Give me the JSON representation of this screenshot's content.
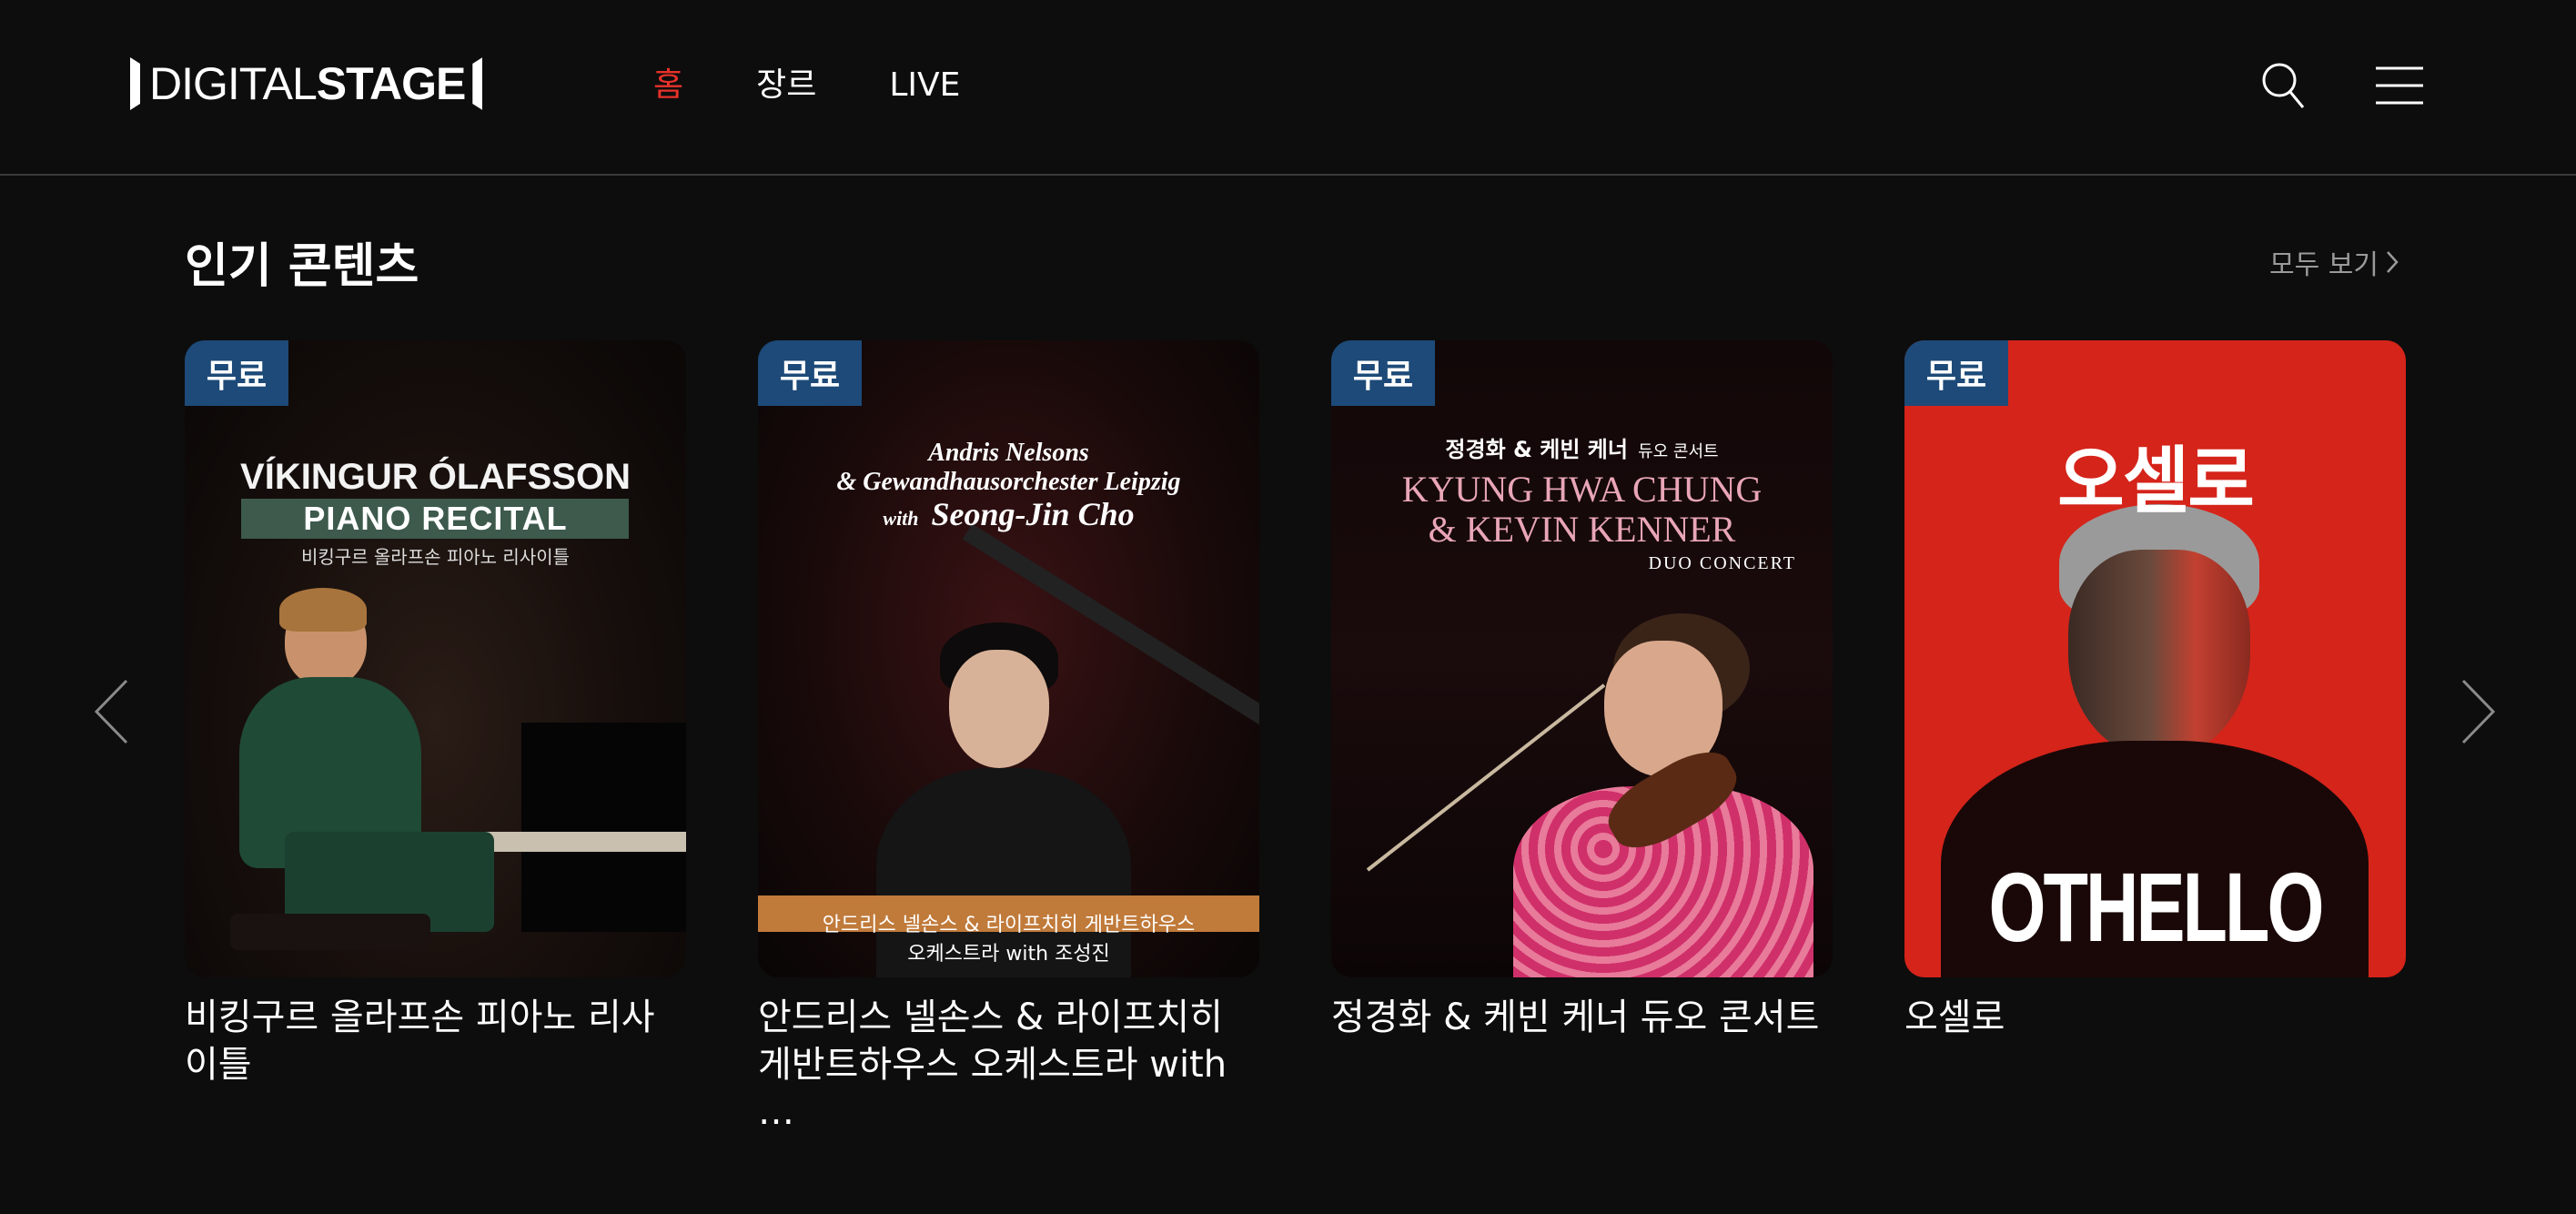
{
  "header": {
    "logo_part1": "DIGITAL",
    "logo_part2": "STAGE",
    "nav": [
      {
        "label": "홈",
        "active": true
      },
      {
        "label": "장르",
        "active": false
      },
      {
        "label": "LIVE",
        "active": false
      }
    ]
  },
  "section": {
    "title": "인기 콘텐츠",
    "view_all": "모두 보기"
  },
  "cards": [
    {
      "badge": "무료",
      "caption": "비킹구르 올라프손 피아노 리사이틀",
      "poster": {
        "line1": "VÍKINGUR ÓLAFSSON",
        "line2": "PIANO RECITAL",
        "line3": "비킹구르 올라프손 피아노 리사이틀"
      }
    },
    {
      "badge": "무료",
      "caption": "안드리스 넬손스 & 라이프치히 게반트하우스 오케스트라 with …",
      "poster": {
        "line1": "Andris Nelsons",
        "line2": "& Gewandhausorchester Leipzig",
        "line3": "with",
        "line4": "Seong-Jin Cho",
        "line5": "안드리스 넬손스 & 라이프치히 게반트하우스",
        "line6": "오케스트라  with 조성진"
      }
    },
    {
      "badge": "무료",
      "caption": "정경화 & 케빈 케너 듀오 콘서트",
      "poster": {
        "line1": "정경화 & 케빈 케너",
        "line1b": "듀오 콘서트",
        "line2": "KYUNG HWA CHUNG",
        "line3": "& KEVIN KENNER",
        "line4": "DUO CONCERT"
      }
    },
    {
      "badge": "무료",
      "caption": "오셀로",
      "poster": {
        "line1": "오셀로",
        "line2": "OTHELLO"
      }
    }
  ],
  "colors": {
    "background": "#0d0d0d",
    "accent": "#e8322a",
    "badge": "#1d4a78",
    "muted": "#9a9a9a"
  },
  "icons": [
    "search-icon",
    "hamburger-menu-icon",
    "chevron-left-icon",
    "chevron-right-icon",
    "chevron-right-small-icon"
  ]
}
